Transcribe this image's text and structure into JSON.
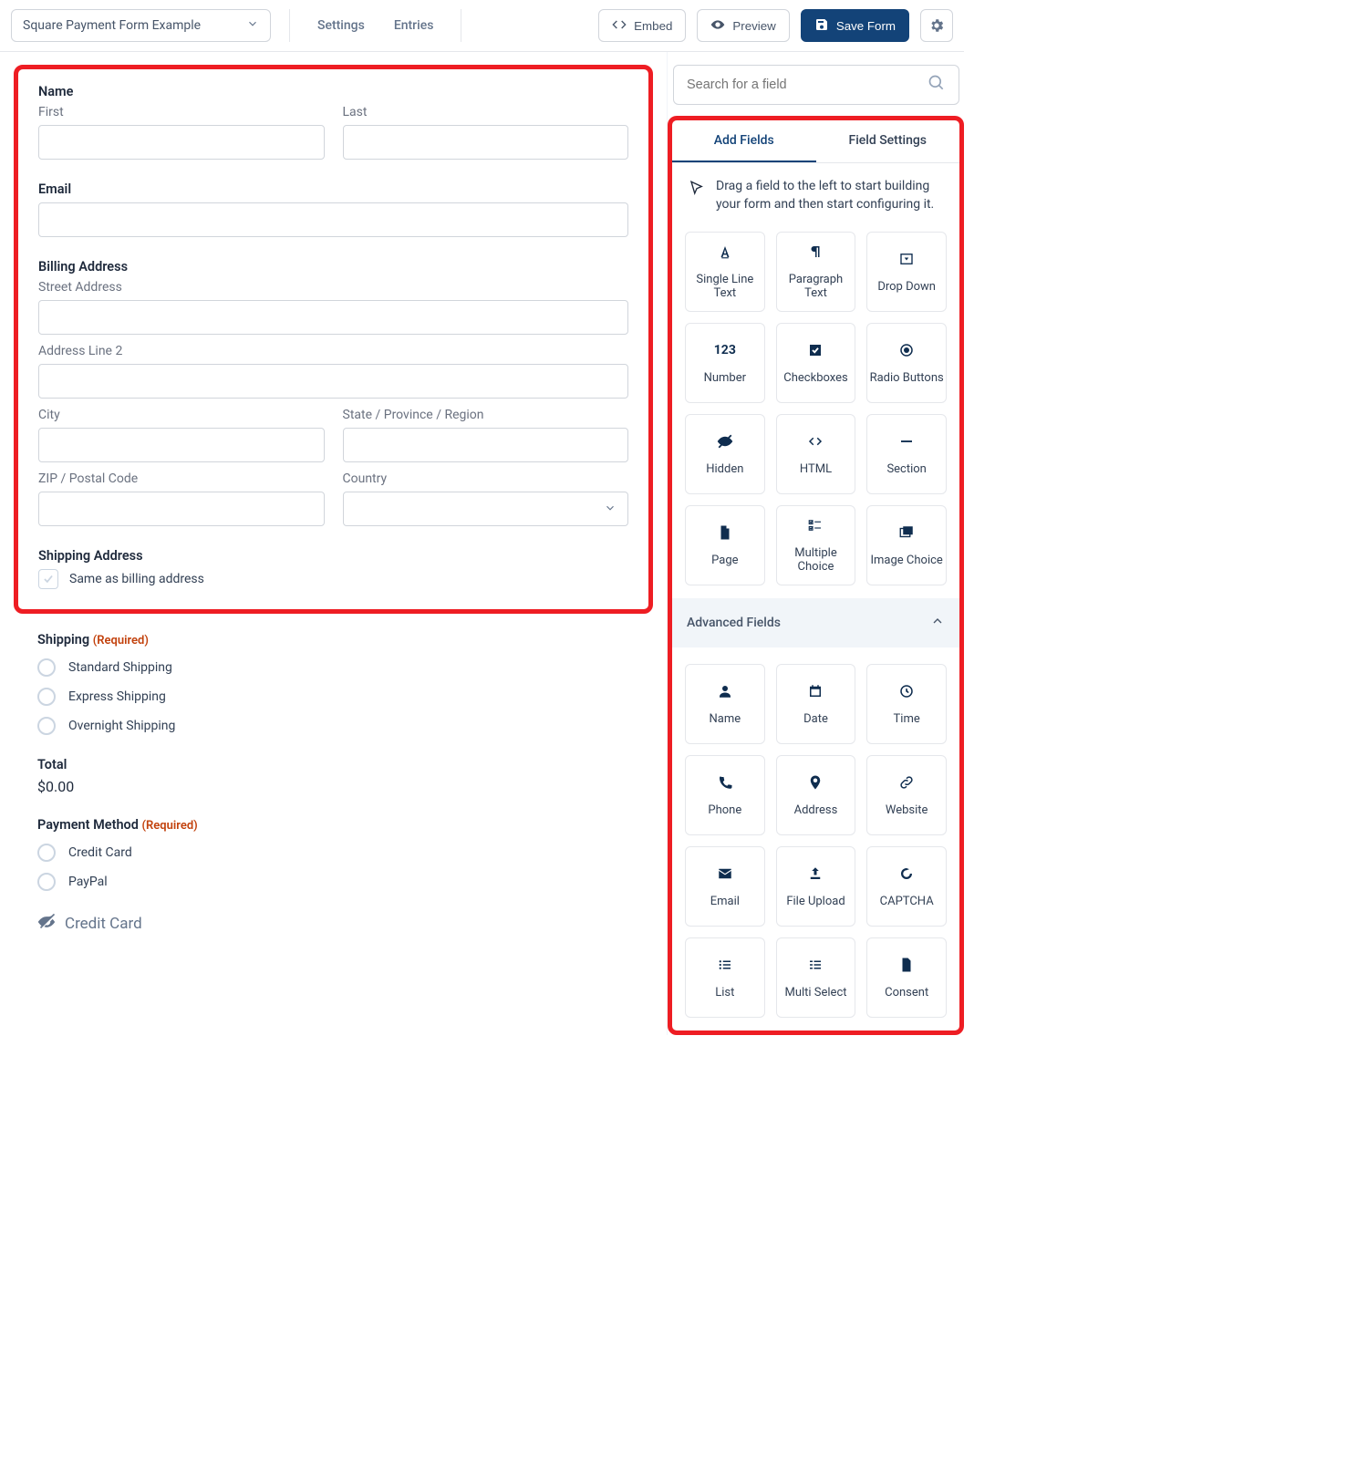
{
  "toolbar": {
    "form_selector": "Square Payment Form Example",
    "settings": "Settings",
    "entries": "Entries",
    "embed": "Embed",
    "preview": "Preview",
    "save": "Save Form"
  },
  "canvas": {
    "name": {
      "label": "Name",
      "first": "First",
      "last": "Last"
    },
    "email": {
      "label": "Email"
    },
    "billing": {
      "label": "Billing Address",
      "street": "Street Address",
      "line2": "Address Line 2",
      "city": "City",
      "state": "State / Province / Region",
      "zip": "ZIP / Postal Code",
      "country": "Country"
    },
    "shipping_addr": {
      "label": "Shipping Address",
      "same": "Same as billing address"
    },
    "shipping_opts": {
      "label": "Shipping",
      "required": "(Required)",
      "opts": [
        "Standard Shipping",
        "Express Shipping",
        "Overnight Shipping"
      ]
    },
    "total": {
      "label": "Total",
      "value": "$0.00"
    },
    "payment": {
      "label": "Payment Method",
      "required": "(Required)",
      "opts": [
        "Credit Card",
        "PayPal"
      ]
    },
    "cc_header": "Credit Card"
  },
  "sidebar": {
    "search_placeholder": "Search for a field",
    "tabs": {
      "add": "Add Fields",
      "settings": "Field Settings"
    },
    "hint": "Drag a field to the left to start building your form and then start configuring it.",
    "standard": [
      "Single Line Text",
      "Paragraph Text",
      "Drop Down",
      "Number",
      "Checkboxes",
      "Radio Buttons",
      "Hidden",
      "HTML",
      "Section",
      "Page",
      "Multiple Choice",
      "Image Choice"
    ],
    "advanced_header": "Advanced Fields",
    "advanced": [
      "Name",
      "Date",
      "Time",
      "Phone",
      "Address",
      "Website",
      "Email",
      "File Upload",
      "CAPTCHA",
      "List",
      "Multi Select",
      "Consent"
    ]
  }
}
